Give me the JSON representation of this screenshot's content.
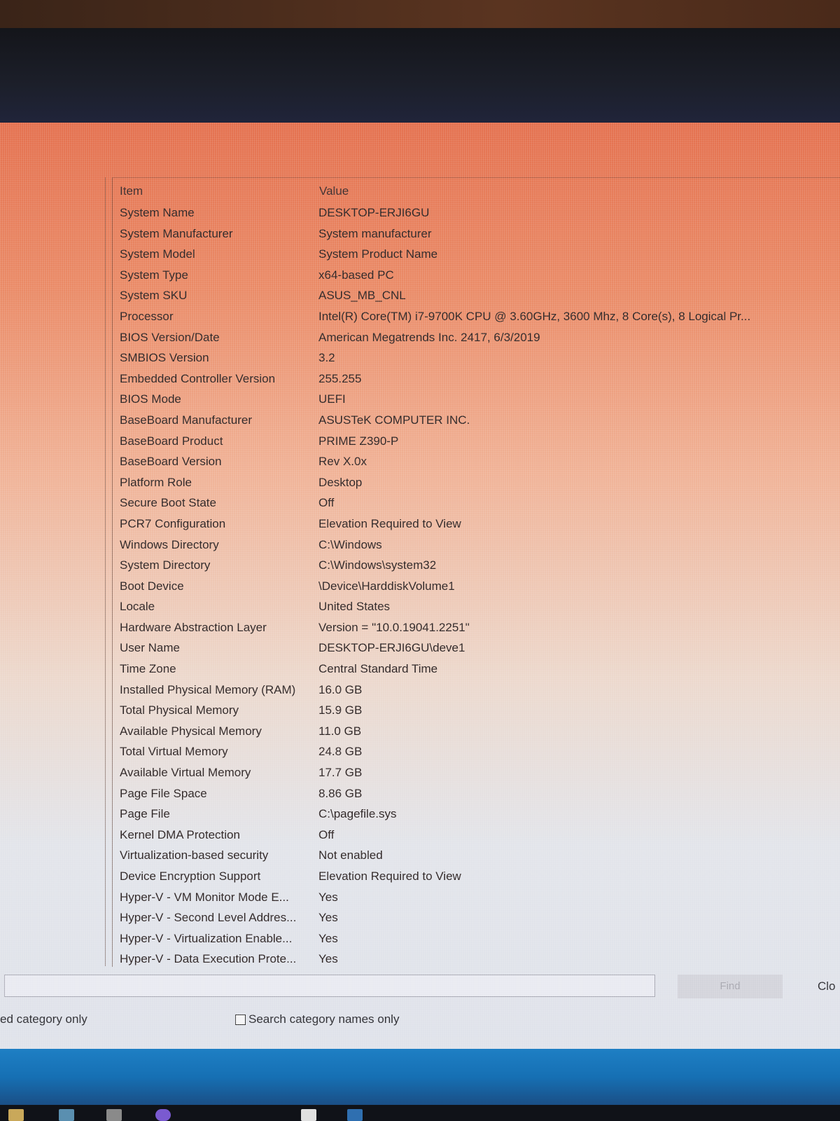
{
  "table": {
    "header_item": "Item",
    "header_value": "Value",
    "rows": [
      {
        "item": "System Name",
        "value": "DESKTOP-ERJI6GU"
      },
      {
        "item": "System Manufacturer",
        "value": "System manufacturer"
      },
      {
        "item": "System Model",
        "value": "System Product Name"
      },
      {
        "item": "System Type",
        "value": "x64-based PC"
      },
      {
        "item": "System SKU",
        "value": "ASUS_MB_CNL"
      },
      {
        "item": "Processor",
        "value": "Intel(R) Core(TM) i7-9700K CPU @ 3.60GHz, 3600 Mhz, 8 Core(s), 8 Logical Pr..."
      },
      {
        "item": "BIOS Version/Date",
        "value": "American Megatrends Inc. 2417, 6/3/2019"
      },
      {
        "item": "SMBIOS Version",
        "value": "3.2"
      },
      {
        "item": "Embedded Controller Version",
        "value": "255.255"
      },
      {
        "item": "BIOS Mode",
        "value": "UEFI"
      },
      {
        "item": "BaseBoard Manufacturer",
        "value": "ASUSTeK COMPUTER INC."
      },
      {
        "item": "BaseBoard Product",
        "value": "PRIME Z390-P"
      },
      {
        "item": "BaseBoard Version",
        "value": "Rev X.0x"
      },
      {
        "item": "Platform Role",
        "value": "Desktop"
      },
      {
        "item": "Secure Boot State",
        "value": "Off"
      },
      {
        "item": "PCR7 Configuration",
        "value": "Elevation Required to View"
      },
      {
        "item": "Windows Directory",
        "value": "C:\\Windows"
      },
      {
        "item": "System Directory",
        "value": "C:\\Windows\\system32"
      },
      {
        "item": "Boot Device",
        "value": "\\Device\\HarddiskVolume1"
      },
      {
        "item": "Locale",
        "value": "United States"
      },
      {
        "item": "Hardware Abstraction Layer",
        "value": "Version = \"10.0.19041.2251\""
      },
      {
        "item": "User Name",
        "value": "DESKTOP-ERJI6GU\\deve1"
      },
      {
        "item": "Time Zone",
        "value": "Central Standard Time"
      },
      {
        "item": "Installed Physical Memory (RAM)",
        "value": "16.0 GB"
      },
      {
        "item": "Total Physical Memory",
        "value": "15.9 GB"
      },
      {
        "item": "Available Physical Memory",
        "value": "11.0 GB"
      },
      {
        "item": "Total Virtual Memory",
        "value": "24.8 GB"
      },
      {
        "item": "Available Virtual Memory",
        "value": "17.7 GB"
      },
      {
        "item": "Page File Space",
        "value": "8.86 GB"
      },
      {
        "item": "Page File",
        "value": "C:\\pagefile.sys"
      },
      {
        "item": "Kernel DMA Protection",
        "value": "Off"
      },
      {
        "item": "Virtualization-based security",
        "value": "Not enabled"
      },
      {
        "item": "Device Encryption Support",
        "value": "Elevation Required to View"
      },
      {
        "item": "Hyper-V - VM Monitor Mode E...",
        "value": "Yes"
      },
      {
        "item": "Hyper-V - Second Level Addres...",
        "value": "Yes"
      },
      {
        "item": "Hyper-V - Virtualization Enable...",
        "value": "Yes"
      },
      {
        "item": "Hyper-V - Data Execution Prote...",
        "value": "Yes"
      }
    ]
  },
  "find": {
    "input_value": "",
    "find_label": "Find",
    "close_label": "Clo",
    "search_selected_label": "ed category only",
    "search_names_label": "Search category names only",
    "search_names_checked": false
  },
  "colors": {
    "window_top": "#e4704e",
    "window_bottom": "#dfe2ea",
    "text": "#2b2222",
    "desktop_blue": "#1e7fc4"
  }
}
